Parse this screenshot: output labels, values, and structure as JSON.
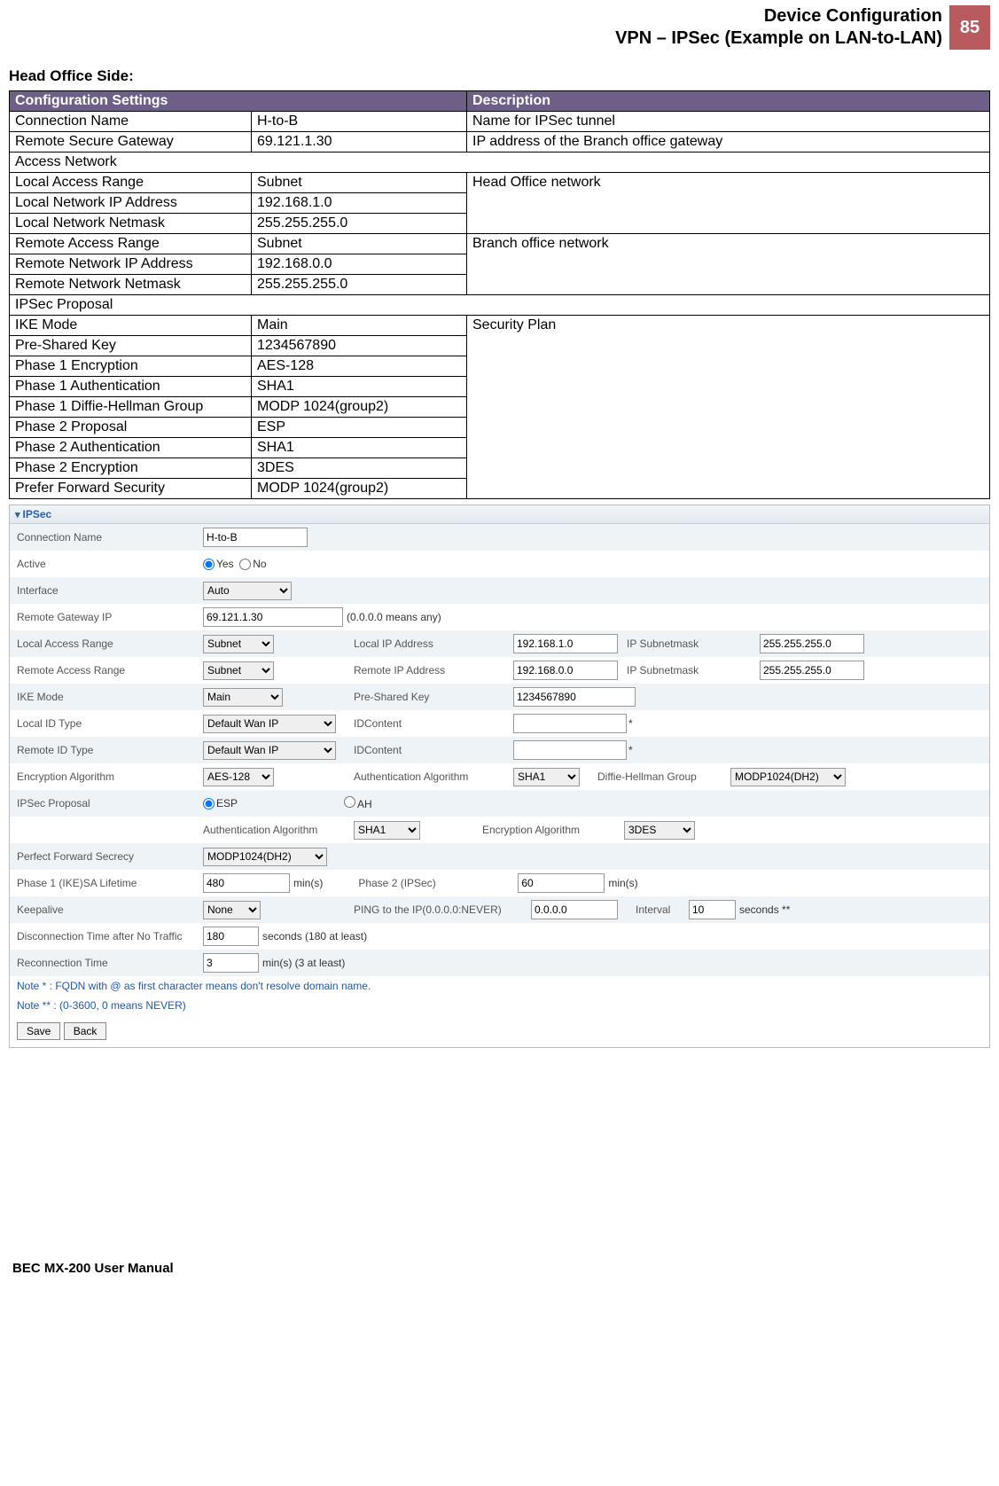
{
  "header": {
    "line1": "Device Configuration",
    "line2": "VPN – IPSec (Example on LAN-to-LAN)",
    "page_number": "85"
  },
  "section_title": "Head Office Side:",
  "cfg_table": {
    "header_settings": "Configuration Settings",
    "header_desc": "Description"
  },
  "rows": {
    "conn_name_l": "Connection Name",
    "conn_name_v": "H-to-B",
    "conn_name_d": "Name for IPSec tunnel",
    "rsg_l": "Remote Secure Gateway",
    "rsg_v": "69.121.1.30",
    "rsg_d": "IP address of the Branch office gateway",
    "access_net": "Access Network",
    "lar_l": "Local Access Range",
    "lar_v": "Subnet",
    "lar_d": "Head Office network",
    "lnip_l": "Local Network IP Address",
    "lnip_v": "192.168.1.0",
    "lnnm_l": "Local Network Netmask",
    "lnnm_v": "255.255.255.0",
    "rar_l": "Remote Access Range",
    "rar_v": "Subnet",
    "rar_d": "Branch office network",
    "rnip_l": "Remote Network IP Address",
    "rnip_v": "192.168.0.0",
    "rnnm_l": "Remote Network Netmask",
    "rnnm_v": "255.255.255.0",
    "ipsec_prop": "IPSec Proposal",
    "ike_l": "IKE Mode",
    "ike_v": "Main",
    "ike_d": "Security Plan",
    "psk_l": "Pre-Shared Key",
    "psk_v": "1234567890",
    "p1e_l": "Phase 1 Encryption",
    "p1e_v": "AES-128",
    "p1a_l": "Phase 1 Authentication",
    "p1a_v": "SHA1",
    "p1dh_l": "Phase 1 Diffie-Hellman Group",
    "p1dh_v": "MODP 1024(group2)",
    "p2p_l": "Phase 2 Proposal",
    "p2p_v": "ESP",
    "p2a_l": "Phase 2 Authentication",
    "p2a_v": "SHA1",
    "p2e_l": "Phase 2 Encryption",
    "p2e_v": "3DES",
    "pfs_l": "Prefer Forward Security",
    "pfs_v": "MODP 1024(group2)"
  },
  "shot": {
    "title": "IPSec",
    "labels": {
      "conn_name": "Connection Name",
      "active": "Active",
      "yes": "Yes",
      "no": "No",
      "interface": "Interface",
      "rgw": "Remote Gateway IP",
      "rgw_hint": "(0.0.0.0 means any)",
      "lar": "Local Access Range",
      "lip": "Local IP Address",
      "ipsn": "IP Subnetmask",
      "rar": "Remote Access Range",
      "rip": "Remote IP Address",
      "ike": "IKE Mode",
      "psk": "Pre-Shared Key",
      "lidt": "Local ID Type",
      "idc": "IDContent",
      "ridt": "Remote ID Type",
      "enc": "Encryption Algorithm",
      "auth": "Authentication Algorithm",
      "dhg": "Diffie-Hellman Group",
      "ipsecprop": "IPSec Proposal",
      "esp": "ESP",
      "ah": "AH",
      "pfs": "Perfect Forward Secrecy",
      "p1life": "Phase 1 (IKE)SA Lifetime",
      "mins": "min(s)",
      "p2": "Phase 2 (IPSec)",
      "keepalive": "Keepalive",
      "pingto": "PING to the IP(0.0.0.0:NEVER)",
      "interval": "Interval",
      "sec": "seconds **",
      "disc": "Disconnection Time after No Traffic",
      "disc_hint": "seconds (180 at least)",
      "recon": "Reconnection Time",
      "recon_hint": "min(s) (3 at least)"
    },
    "values": {
      "conn_name": "H-to-B",
      "interface": "Auto",
      "rgw": "69.121.1.30",
      "lar": "Subnet",
      "lip": "192.168.1.0",
      "lsn": "255.255.255.0",
      "rar": "Subnet",
      "rip": "192.168.0.0",
      "rsn": "255.255.255.0",
      "ike": "Main",
      "psk": "1234567890",
      "lidt": "Default Wan IP",
      "ridt": "Default Wan IP",
      "enc": "AES-128",
      "auth": "SHA1",
      "dhg": "MODP1024(DH2)",
      "auth2": "SHA1",
      "enc2": "3DES",
      "pfs": "MODP1024(DH2)",
      "p1life": "480",
      "p2": "60",
      "keepalive": "None",
      "pingip": "0.0.0.0",
      "interval": "10",
      "disc": "180",
      "recon": "3"
    },
    "notes": {
      "n1": "Note * : FQDN with @ as first character means don't resolve domain name.",
      "n2": "Note ** : (0-3600, 0 means NEVER)"
    },
    "buttons": {
      "save": "Save",
      "back": "Back"
    }
  },
  "footer": "BEC MX-200 User Manual"
}
